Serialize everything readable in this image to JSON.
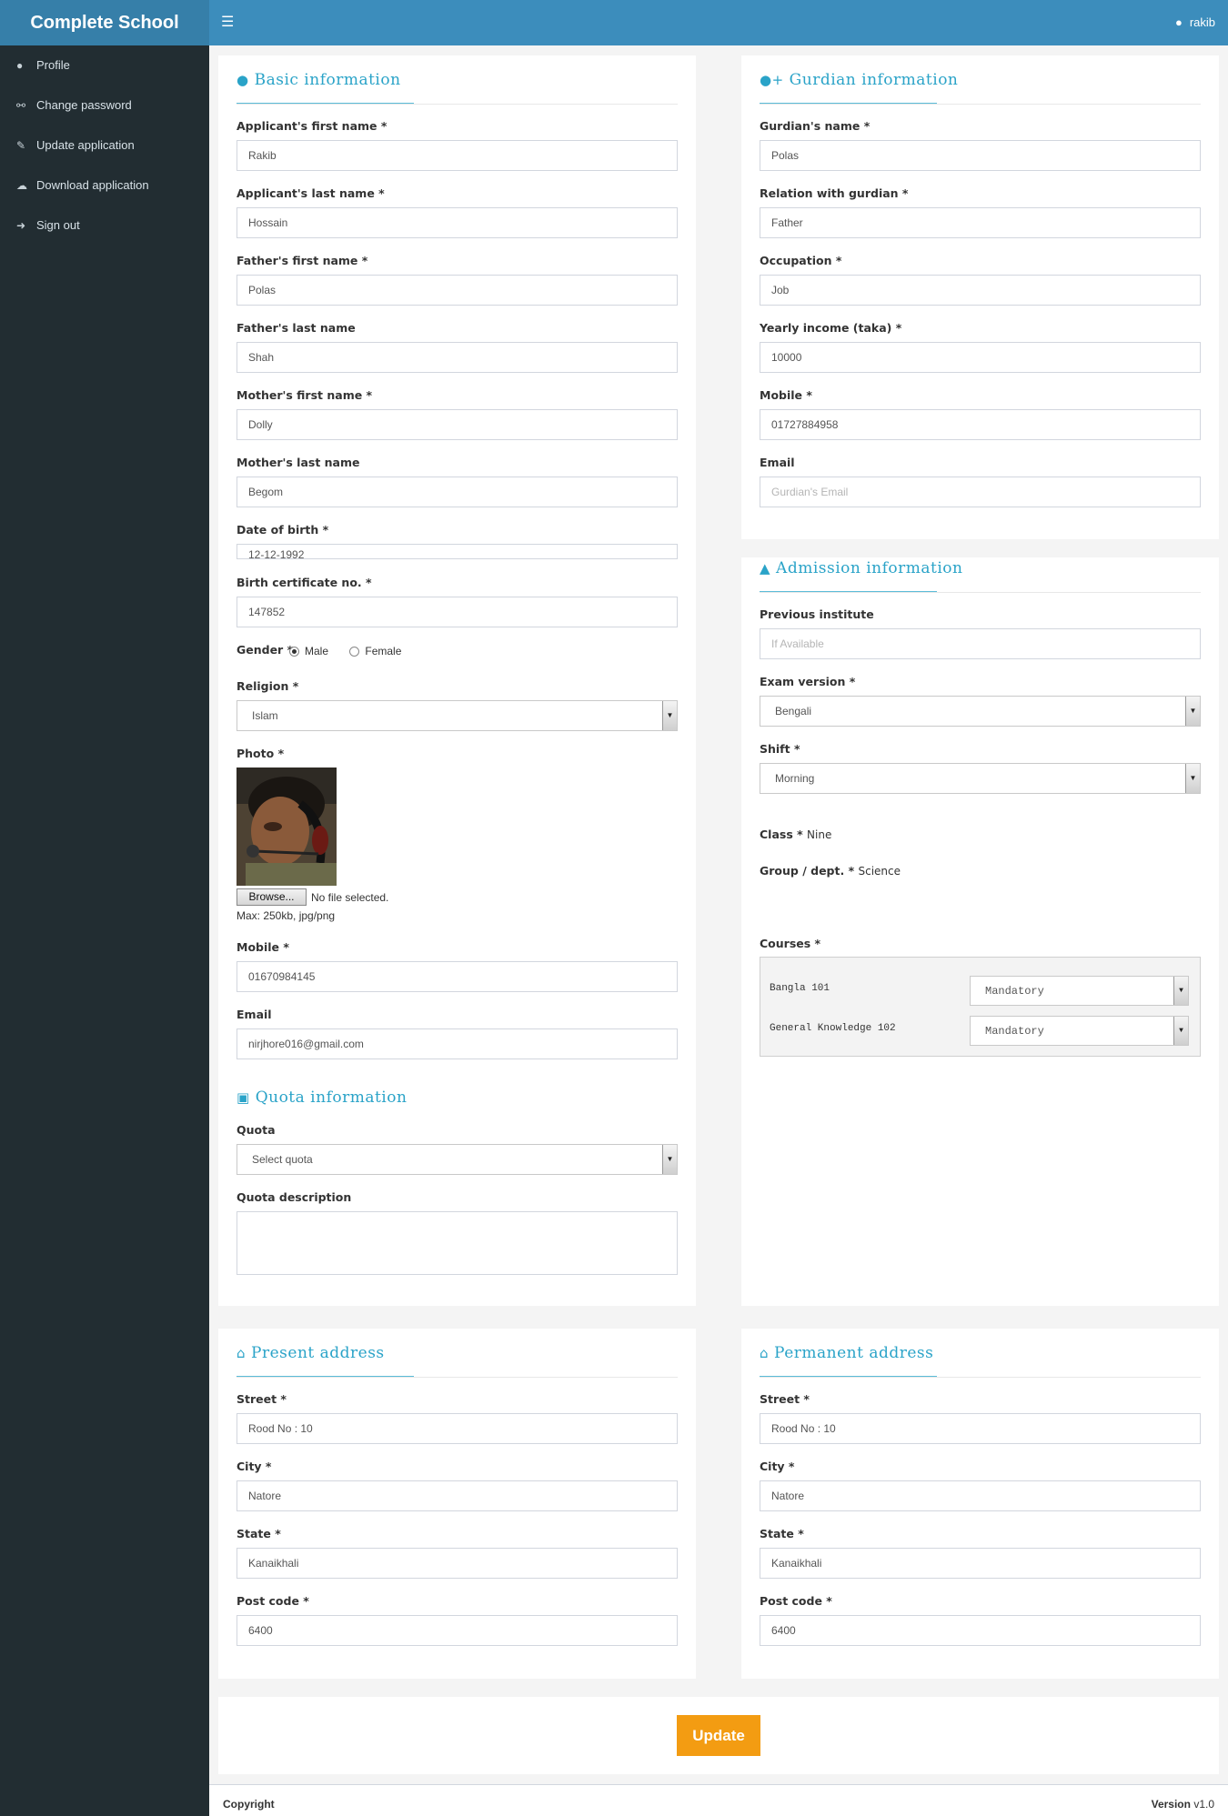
{
  "app": {
    "brand": "Complete School",
    "menu_icon": "menu-icon",
    "user_name": "rakib"
  },
  "sidebar": {
    "items": [
      {
        "label": "Profile",
        "icon": "user-icon"
      },
      {
        "label": "Change password",
        "icon": "key-icon"
      },
      {
        "label": "Update application",
        "icon": "pencil-icon"
      },
      {
        "label": "Download application",
        "icon": "cloud-download-icon"
      },
      {
        "label": "Sign out",
        "icon": "sign-out-icon"
      }
    ]
  },
  "basic": {
    "title": "Basic information",
    "first_name_label": "Applicant's first name *",
    "first_name": "Rakib",
    "last_name_label": "Applicant's last name *",
    "last_name": "Hossain",
    "father_first_label": "Father's first name *",
    "father_first": "Polas",
    "father_last_label": "Father's last name",
    "father_last": "Shah",
    "mother_first_label": "Mother's first name *",
    "mother_first": "Dolly",
    "mother_last_label": "Mother's last name",
    "mother_last": "Begom",
    "dob_label": "Date of birth *",
    "dob": "12-12-1992",
    "birth_cert_label": "Birth certificate no. *",
    "birth_cert": "147852",
    "gender_label": "Gender *",
    "gender_male": "Male",
    "gender_female": "Female",
    "religion_label": "Religion *",
    "religion": "Islam",
    "photo_label": "Photo *",
    "browse": "Browse...",
    "no_file": "No file selected.",
    "photo_hint": "Max: 250kb, jpg/png",
    "mobile_label": "Mobile *",
    "mobile": "01670984145",
    "email_label": "Email",
    "email": "nirjhore016@gmail.com"
  },
  "quota": {
    "title": "Quota information",
    "quota_label": "Quota",
    "quota_value": "Select quota",
    "desc_label": "Quota description",
    "desc_value": ""
  },
  "guardian": {
    "title": "Gurdian information",
    "name_label": "Gurdian's name *",
    "name": "Polas",
    "relation_label": "Relation with gurdian *",
    "relation": "Father",
    "occupation_label": "Occupation *",
    "occupation": "Job",
    "income_label": "Yearly income (taka) *",
    "income": "10000",
    "mobile_label": "Mobile *",
    "mobile": "01727884958",
    "email_label": "Email",
    "email_placeholder": "Gurdian's Email"
  },
  "admission": {
    "title": "Admission information",
    "prev_label": "Previous institute",
    "prev_placeholder": "If Available",
    "exam_label": "Exam version *",
    "exam": "Bengali",
    "shift_label": "Shift *",
    "shift": "Morning",
    "class_label": "Class *",
    "class_value": "Nine",
    "group_label": "Group / dept. *",
    "group_value": "Science",
    "courses_label": "Courses *",
    "courses": [
      {
        "name": "Bangla 101",
        "type": "Mandatory"
      },
      {
        "name": "General Knowledge 102",
        "type": "Mandatory"
      }
    ]
  },
  "present": {
    "title": "Present address",
    "street_label": "Street *",
    "street": "Rood No : 10",
    "city_label": "City *",
    "city": "Natore",
    "state_label": "State *",
    "state": "Kanaikhali",
    "post_label": "Post code *",
    "post": "6400"
  },
  "permanent": {
    "title": "Permanent address",
    "street_label": "Street *",
    "street": "Rood No : 10",
    "city_label": "City *",
    "city": "Natore",
    "state_label": "State *",
    "state": "Kanaikhali",
    "post_label": "Post code *",
    "post": "6400"
  },
  "actions": {
    "update": "Update"
  },
  "footer": {
    "copyright": "Copyright",
    "version_label": "Version",
    "version": "v1.0"
  },
  "colors": {
    "header": "#3c8dbc",
    "sidebar": "#222d32",
    "accent_title": "#2aa3c8",
    "button": "#f39c12"
  }
}
